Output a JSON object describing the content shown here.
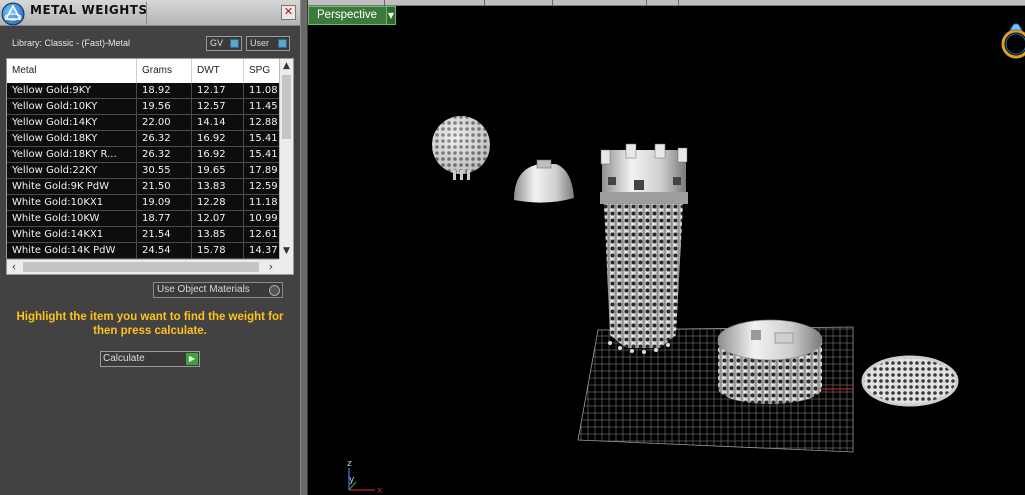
{
  "panel": {
    "title": "METAL WEIGHTS",
    "close_label": "✕",
    "library_label": "Library: Classic - (Fast)-Metal",
    "toggle_gv": "GV",
    "toggle_user": "User",
    "columns": [
      "Metal",
      "Grams",
      "DWT",
      "SPG"
    ],
    "rows": [
      [
        "Yellow Gold:9KY",
        "18.92",
        "12.17",
        "11.08"
      ],
      [
        "Yellow Gold:10KY",
        "19.56",
        "12.57",
        "11.45"
      ],
      [
        "Yellow Gold:14KY",
        "22.00",
        "14.14",
        "12.88"
      ],
      [
        "Yellow Gold:18KY",
        "26.32",
        "16.92",
        "15.41"
      ],
      [
        "Yellow Gold:18KY R...",
        "26.32",
        "16.92",
        "15.41"
      ],
      [
        "Yellow Gold:22KY",
        "30.55",
        "19.65",
        "17.89"
      ],
      [
        "White Gold:9K PdW",
        "21.50",
        "13.83",
        "12.59"
      ],
      [
        "White Gold:10KX1",
        "19.09",
        "12.28",
        "11.18"
      ],
      [
        "White Gold:10KW",
        "18.77",
        "12.07",
        "10.99"
      ],
      [
        "White Gold:14KX1",
        "21.54",
        "13.85",
        "12.61"
      ],
      [
        "White Gold:14K PdW",
        "24.54",
        "15.78",
        "14.37"
      ]
    ],
    "use_object_materials": "Use Object Materials",
    "instruction": "Highlight the item you want to find the weight for then press calculate.",
    "calculate_label": "Calculate"
  },
  "viewport": {
    "view_label": "Perspective",
    "axis_z": "z",
    "axis_y": "y",
    "axis_x": "x"
  },
  "colors": {
    "panel_bg": "#424242",
    "instruction_text": "#ffc21a",
    "viewport_tab": "#3c7a3c",
    "viewport_bg": "#000000"
  }
}
